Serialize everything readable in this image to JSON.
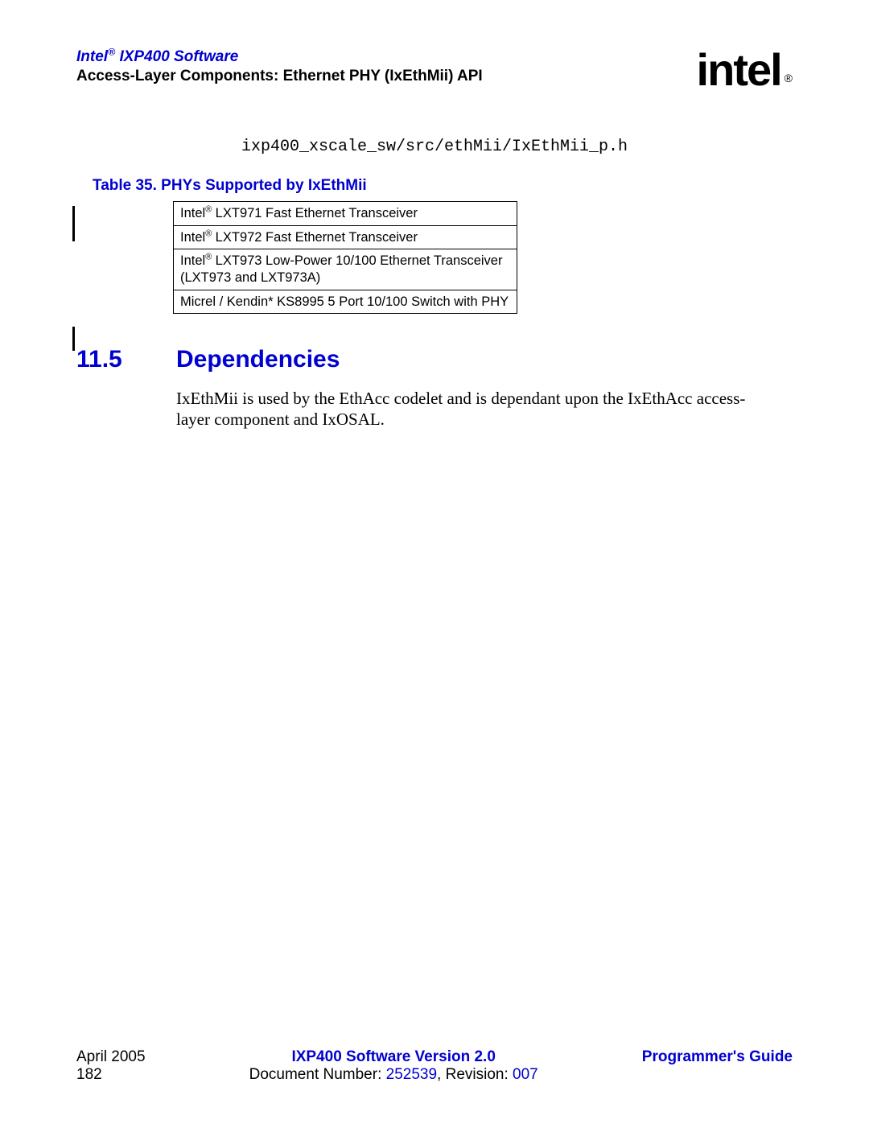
{
  "header": {
    "title_prefix": "Intel",
    "title_reg": "®",
    "title_rest": " IXP400 Software",
    "subtitle": "Access-Layer Components: Ethernet PHY (IxEthMii) API"
  },
  "logo": {
    "text": "intel",
    "trade": "®"
  },
  "code_path": "ixp400_xscale_sw/src/ethMii/IxEthMii_p.h",
  "table": {
    "caption": "Table 35.  PHYs Supported by IxEthMii",
    "rows": [
      {
        "pre": "Intel",
        "sup": "®",
        "rest": " LXT971 Fast Ethernet Transceiver"
      },
      {
        "pre": "Intel",
        "sup": "®",
        "rest": " LXT972 Fast Ethernet Transceiver"
      },
      {
        "pre": "Intel",
        "sup": "®",
        "rest": " LXT973 Low-Power 10/100 Ethernet Transceiver (LXT973 and LXT973A)"
      },
      {
        "pre": "Micrel / Kendin* KS8995 5 Port 10/100 Switch with PHY",
        "sup": "",
        "rest": ""
      }
    ]
  },
  "section": {
    "number": "11.5",
    "title": "Dependencies",
    "body": "IxEthMii is used by the EthAcc codelet and is dependant upon the IxEthAcc access-layer component and IxOSAL."
  },
  "footer": {
    "left_line1": "April 2005",
    "left_line2": "182",
    "center_line1": "IXP400 Software Version 2.0",
    "center_line2_pre": "Document Number: ",
    "center_docnum": "252539",
    "center_line2_mid": ", Revision: ",
    "center_rev": "007",
    "right_line1": "Programmer's Guide"
  }
}
